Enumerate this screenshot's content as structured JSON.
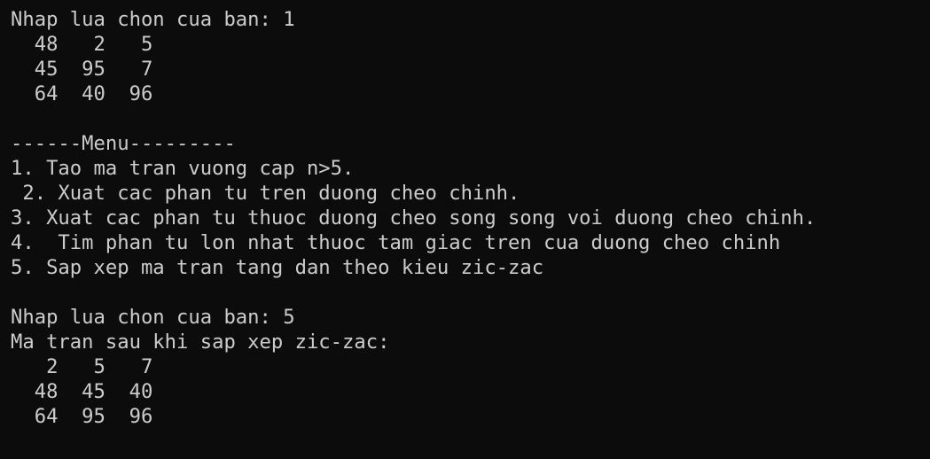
{
  "console": {
    "lines": [
      "Nhap lua chon cua ban: 1",
      "  48   2   5",
      "  45  95   7",
      "  64  40  96",
      "",
      "------Menu---------",
      "1. Tao ma tran vuong cap n>5.",
      " 2. Xuat cac phan tu tren duong cheo chinh.",
      "3. Xuat cac phan tu thuoc duong cheo song song voi duong cheo chinh.",
      "4.  Tim phan tu lon nhat thuoc tam giac tren cua duong cheo chinh",
      "5. Sap xep ma tran tang dan theo kieu zic-zac",
      "",
      "Nhap lua chon cua ban: 5",
      "Ma tran sau khi sap xep zic-zac:",
      "   2   5   7",
      "  48  45  40",
      "  64  95  96"
    ]
  },
  "colors": {
    "background": "#0c0c0c",
    "text": "#cccccc"
  }
}
